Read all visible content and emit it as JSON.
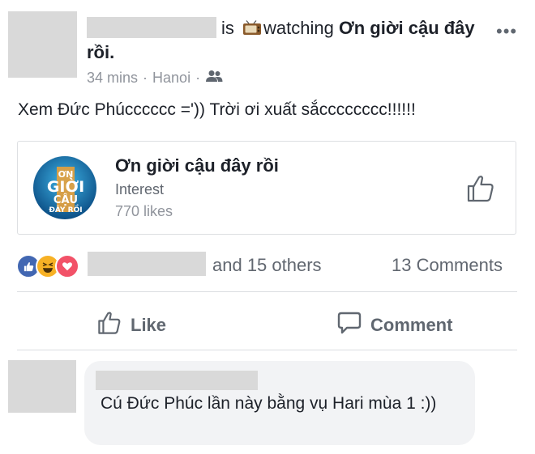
{
  "post": {
    "is_label": "is",
    "activity_icon": "tv-icon",
    "watching_label": "watching",
    "show_title": "Ơn giời cậu đây rồi.",
    "time": "34 mins",
    "location": "Hanoi",
    "separator": "·",
    "privacy_icon": "friends-icon",
    "more_label": "•••",
    "text": "Xem Đức Phúcccccc =')) Trời ơi xuất sắcccccccc!!!!!!"
  },
  "card": {
    "logo_icon": "show-logo",
    "title": "Ơn giời cậu đây rồi",
    "subtitle": "Interest",
    "likes": "770 likes",
    "like_icon": "thumbs-up-icon"
  },
  "reactions": {
    "icons": [
      "like-reaction-icon",
      "haha-reaction-icon",
      "love-reaction-icon"
    ],
    "others_label": "and 15 others",
    "comments_label": "13 Comments"
  },
  "actions": {
    "like_label": "Like",
    "comment_label": "Comment"
  },
  "comment": {
    "text": "Cú Đức Phúc lần này bằng vụ Hari mùa 1 :))"
  },
  "colors": {
    "text": "#1d2129",
    "muted": "#90949c",
    "like_blue": "#4267b2",
    "haha_yellow": "#f7b125",
    "love_red": "#f25268",
    "redaction": "#d9d9d9"
  }
}
